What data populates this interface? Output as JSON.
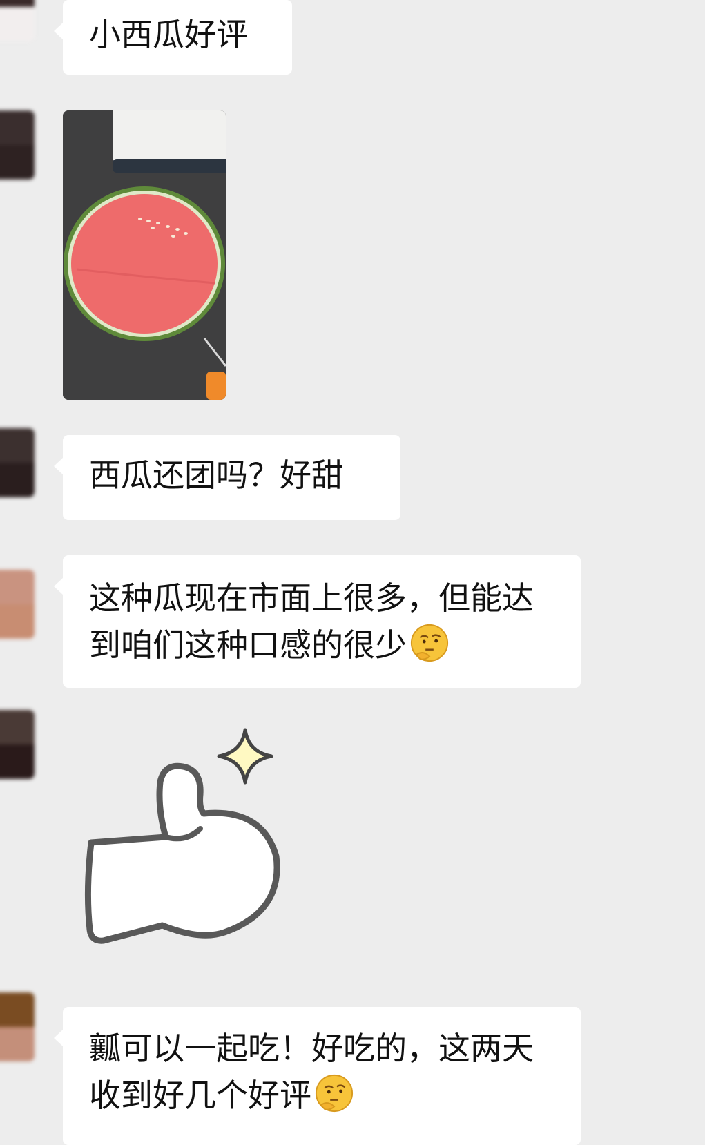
{
  "messages": [
    {
      "id": "m1",
      "type": "text",
      "text": "小西瓜好评",
      "avatar_colors": [
        "#3a2a2a",
        "#f5f1f0"
      ]
    },
    {
      "id": "m2",
      "type": "image",
      "image_description": "watermelon-photo",
      "avatar_colors": [
        "#3a2e2e",
        "#2e2222"
      ]
    },
    {
      "id": "m3",
      "type": "text",
      "text": "西瓜还团吗？好甜",
      "avatar_colors": [
        "#3c302f",
        "#2a1e1e"
      ]
    },
    {
      "id": "m4",
      "type": "text",
      "text": "这种瓜现在市面上很多，但能达到咱们这种口感的很少",
      "emoji": "thinking-face-emoji",
      "avatar_colors": [
        "#c99380",
        "#c88d72"
      ]
    },
    {
      "id": "m5",
      "type": "sticker",
      "sticker": "thumbs-up-sparkle-sticker",
      "avatar_colors": [
        "#4a3a36",
        "#2a1a1a"
      ]
    },
    {
      "id": "m6",
      "type": "text",
      "text": "瓤可以一起吃！好吃的，这两天收到好几个好评",
      "emoji": "thinking-face-emoji",
      "avatar_colors": [
        "#7a4c22",
        "#c48f7a"
      ]
    }
  ],
  "colors": {
    "background": "#ededed",
    "bubble": "#ffffff",
    "text": "#111111",
    "watermelon_flesh": "#ee6b6b",
    "watermelon_rind": "#5f8a3a",
    "emoji_yellow": "#f7c43a"
  }
}
